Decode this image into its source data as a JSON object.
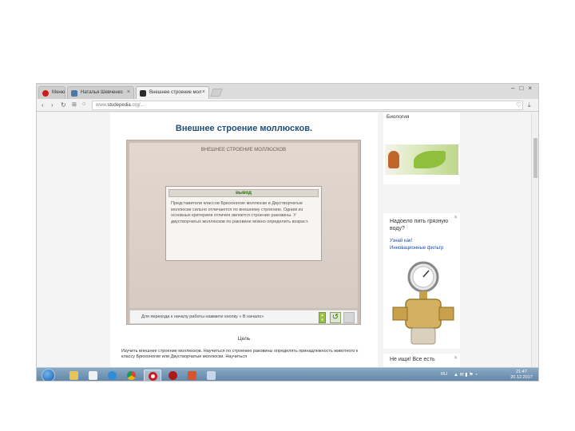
{
  "browser": {
    "tabs": [
      {
        "label": "Меню",
        "icon": "opera-icon",
        "color": "#cc1b1b"
      },
      {
        "label": "Наталья Шевченко",
        "icon": "vk-icon",
        "color": "#4a76a8"
      },
      {
        "label": "Внешнее строение мол",
        "icon": "page-icon",
        "color": "#2b2b2b"
      }
    ],
    "url_domain": "www.",
    "url_host": "studepedia",
    "url_rest": ".org/..."
  },
  "document": {
    "title": "Внешнее строение моллюсков.",
    "slide": {
      "title": "ВНЕШНЕЕ СТРОЕНИЕ МОЛЛЮСКОВ",
      "panel_heading": "вывод",
      "panel_text": "Представители классов Брюхоногие моллюски и Двустворчатые моллюски сильно отличаются по внешнему строению. Одним из основных критериев отличия является строение раковины. У двустворчатых моллюсков по раковине можно определить возраст.",
      "footer_text": "Для перехода к началу работы нажмите кнопку « В начало»"
    },
    "goals_heading": "Цель",
    "body_text": "Изучить внешнее строение моллюсков. Научиться по строению раковины определять принадлежность животного к классу Брюхоногие или Двустворчатые моллюски. Научиться"
  },
  "ads": {
    "ad1_label": "Биология",
    "ad2_title": "Надоело пить грязную воду?",
    "ad2_link": "Узнай как!",
    "ad2_sub": "Инновационные фильтр",
    "ad3_title": "Не ищи! Все есть"
  },
  "taskbar": {
    "tray_lang": "RU",
    "clock_time": "21:47",
    "clock_date": "20.12.2017"
  }
}
